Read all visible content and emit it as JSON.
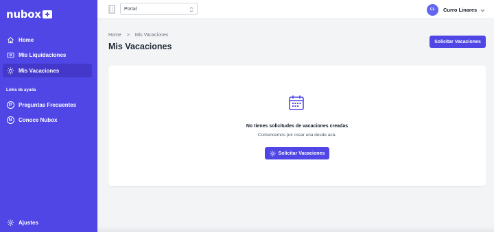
{
  "brand": {
    "logo_text": "nubox"
  },
  "sidebar": {
    "items": [
      {
        "label": "Home",
        "icon": "home-icon"
      },
      {
        "label": "Mis Liquidaciones",
        "icon": "payslip-icon"
      },
      {
        "label": "Mis Vacaciones",
        "icon": "sun-icon",
        "active": true
      }
    ],
    "section_label": "Links de ayuda",
    "help_items": [
      {
        "label": "Preguntas Frecuentes",
        "letter": "P"
      },
      {
        "label": "Conoce Nubox",
        "letter": "N"
      }
    ],
    "settings_label": "Ajustes"
  },
  "topbar": {
    "portal_select_value": "Portal",
    "user_initials": "CL",
    "user_name": "Curro Linares"
  },
  "page": {
    "breadcrumb_home": "Home",
    "breadcrumb_separator": ">",
    "breadcrumb_current": "Mis Vacaciones",
    "title": "Mis Vacaciones",
    "request_button": "Solicitar Vacaciones"
  },
  "empty_state": {
    "title": "No tienes solicitudes de vacaciones creadas",
    "subtitle": "Comencemos por crear una desde acá.",
    "button": "Solicitar Vacaciones",
    "icon": "calendar-icon"
  },
  "colors": {
    "accent": "#4f46e5",
    "accent_dark": "#4338ca",
    "background": "#f3f4f6"
  }
}
